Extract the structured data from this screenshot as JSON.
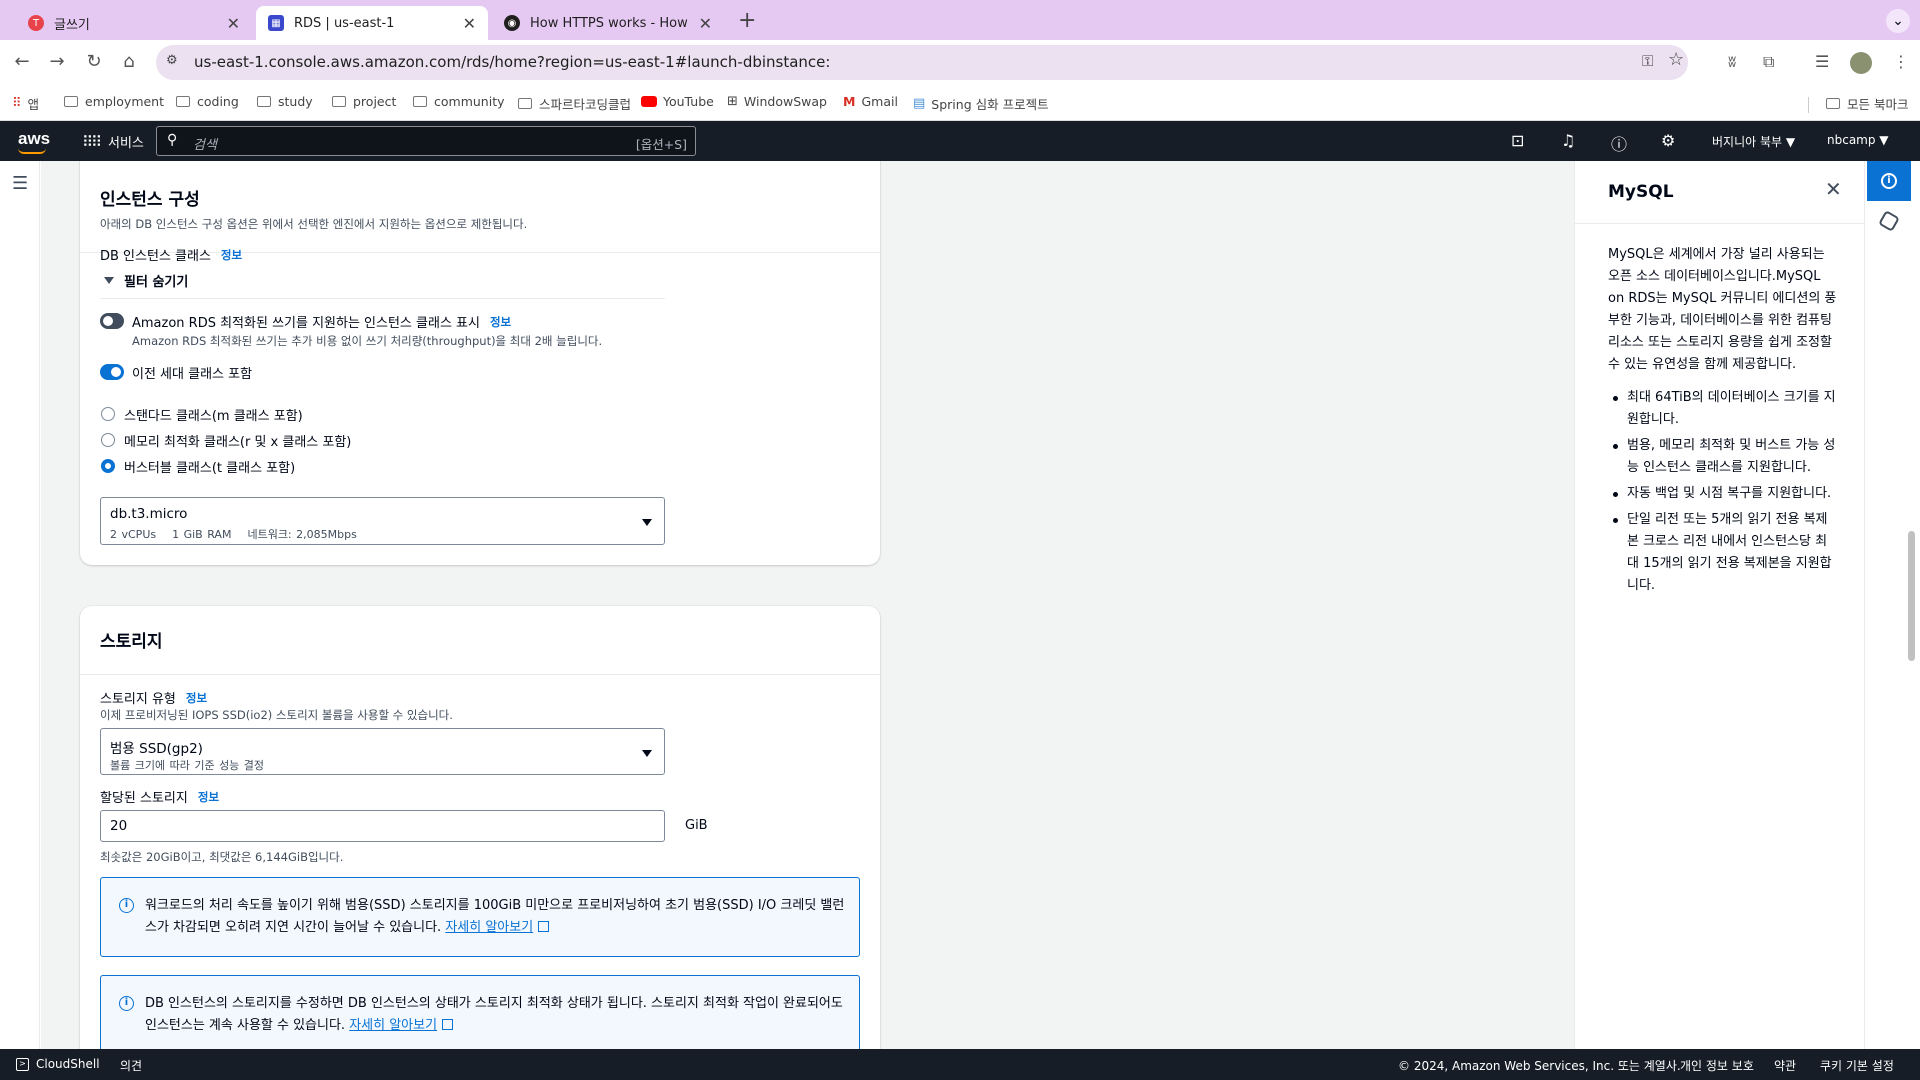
{
  "browser": {
    "tabs": [
      {
        "title": "글쓰기",
        "favicon_color": "#e8434a"
      },
      {
        "title": "RDS | us-east-1",
        "favicon_color": "#3b48cc"
      },
      {
        "title": "How HTTPS works - How HT",
        "favicon_color": "#1f1f1f"
      }
    ],
    "url": "us-east-1.console.aws.amazon.com/rds/home?region=us-east-1#launch-dbinstance:",
    "bookmarks": [
      "앱",
      "employment",
      "coding",
      "study",
      "project",
      "community",
      "스파르타코딩클럽",
      "YouTube",
      "WindowSwap",
      "Gmail",
      "Spring 심화 프로젝트"
    ],
    "all_bookmarks": "모든 북마크"
  },
  "aws": {
    "logo": "aws",
    "services": "서비스",
    "search_placeholder": "검색",
    "search_shortcut": "[옵션+S]",
    "region": "버지니아 북부 ▼",
    "account": "nbcamp ▼"
  },
  "instance": {
    "title": "인스턴스 구성",
    "subtitle": "아래의 DB 인스턴스 구성 옵션은 위에서 선택한 엔진에서 지원하는 옵션으로 제한됩니다.",
    "class_label": "DB 인스턴스 클래스",
    "info": "정보",
    "filter_toggle": "필터 숨기기",
    "optimized_writes_label": "Amazon RDS 최적화된 쓰기를 지원하는 인스턴스 클래스 표시",
    "optimized_writes_desc": "Amazon RDS 최적화된 쓰기는 추가 비용 없이 쓰기 처리량(throughput)을 최대 2배 늘립니다.",
    "optimized_writes_on": false,
    "prev_gen_label": "이전 세대 클래스 포함",
    "prev_gen_on": true,
    "classes": [
      {
        "label": "스탠다드 클래스(m 클래스 포함)",
        "selected": false
      },
      {
        "label": "메모리 최적화 클래스(r 및 x 클래스 포함)",
        "selected": false
      },
      {
        "label": "버스터블 클래스(t 클래스 포함)",
        "selected": true
      }
    ],
    "selected_class": {
      "name": "db.t3.micro",
      "vcpu": "2 vCPUs",
      "ram": "1 GiB RAM",
      "network": "네트워크: 2,085Mbps"
    }
  },
  "storage": {
    "title": "스토리지",
    "type_label": "스토리지 유형",
    "info": "정보",
    "type_desc": "이제 프로비저닝된 IOPS SSD(io2) 스토리지 볼륨을 사용할 수 있습니다.",
    "type_value": "범용 SSD(gp2)",
    "type_value_desc": "볼륨 크기에 따라 기준 성능 결정",
    "allocated_label": "할당된 스토리지",
    "allocated_value": "20",
    "allocated_unit": "GiB",
    "allocated_hint": "최솟값은 20GiB이고, 최댓값은 6,144GiB입니다.",
    "alert1_text": "워크로드의 처리 속도를 높이기 위해 범용(SSD) 스토리지를 100GiB 미만으로 프로비저닝하여 초기 범용(SSD) I/O 크레딧 밸런스가 차감되면 오히려 지연 시간이 늘어날 수 있습니다.",
    "alert1_link": "자세히 알아보기",
    "alert2_text": "DB 인스턴스의 스토리지를 수정하면 DB 인스턴스의 상태가 스토리지 최적화 상태가 됩니다. 스토리지 최적화 작업이 완료되어도 인스턴스는 계속 사용할 수 있습니다.",
    "alert2_link": "자세히 알아보기"
  },
  "help": {
    "title": "MySQL",
    "intro": "MySQL은 세계에서 가장 널리 사용되는 오픈 소스 데이터베이스입니다.MySQL on RDS는 MySQL 커뮤니티 에디션의 풍부한 기능과, 데이터베이스를 위한 컴퓨팅 리소스 또는 스토리지 용량을 쉽게 조정할 수 있는 유연성을 함께 제공합니다.",
    "bullets": [
      "최대 64TiB의 데이터베이스 크기를 지원합니다.",
      "범용, 메모리 최적화 및 버스트 가능 성능 인스턴스 클래스를 지원합니다.",
      "자동 백업 및 시점 복구를 지원합니다.",
      "단일 리전 또는 5개의 읽기 전용 복제본 크로스 리전 내에서 인스턴스당 최대 15개의 읽기 전용 복제본을 지원합니다."
    ]
  },
  "footer": {
    "cloudshell": "CloudShell",
    "feedback": "의견",
    "copyright": "© 2024, Amazon Web Services, Inc. 또는 계열사.",
    "privacy": "개인 정보 보호",
    "terms": "약관",
    "cookies": "쿠키 기본 설정"
  }
}
